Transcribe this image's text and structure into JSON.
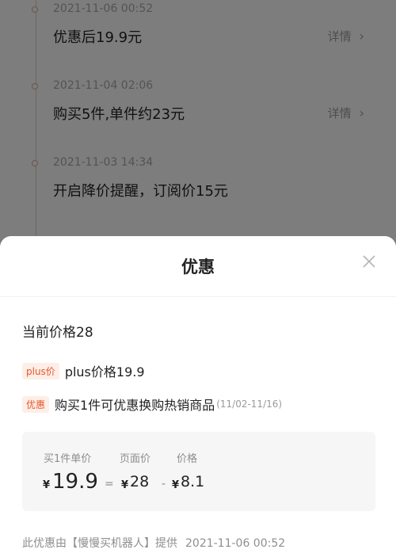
{
  "timeline": {
    "items": [
      {
        "time": "2021-11-06 00:52",
        "text": "优惠后19.9元",
        "detail": "详情"
      },
      {
        "time": "2021-11-04 02:06",
        "text": "购买5件,单件约23元",
        "detail": "详情"
      },
      {
        "time": "2021-11-03 14:34",
        "text": "开启降价提醒，订阅价15元",
        "detail": ""
      }
    ]
  },
  "sheet": {
    "title": "优惠",
    "current_price": "当前价格28",
    "promos": [
      {
        "tag": "plus价",
        "text": "plus价格19.9",
        "range": ""
      },
      {
        "tag": "优惠",
        "text": "购买1件可优惠换购热销商品",
        "range": "(11/02-11/16)"
      }
    ],
    "calc": {
      "label_unit": "买1件单价",
      "label_page": "页面价",
      "label_price": "价格",
      "currency": "¥",
      "unit_value": "19.9",
      "page_value": "28",
      "discount_value": "8.1",
      "eq": "=",
      "minus": "-"
    },
    "footer": {
      "text": "此优惠由【慢慢买机器人】提供",
      "time": "2021-11-06 00:52"
    }
  },
  "colors": {
    "accent": "#e8562c",
    "tag_bg": "#fdeee7",
    "overlay": "rgba(0,0,0,0.5)"
  }
}
